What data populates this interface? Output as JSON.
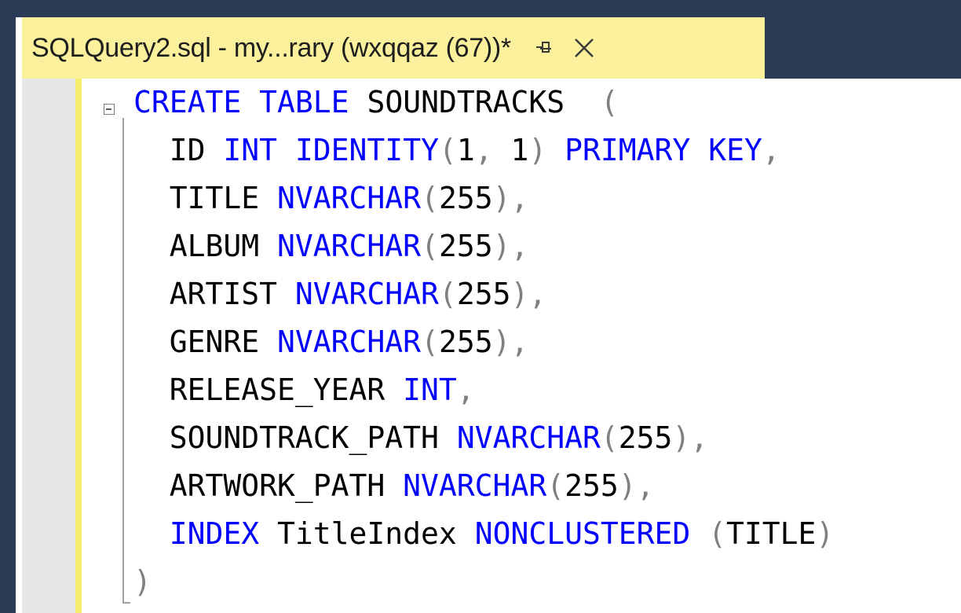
{
  "tab": {
    "title": "SQLQuery2.sql - my...rary (wxqqaz (67))*",
    "pin_glyph": "†",
    "pin_icon": "pin-icon",
    "close_icon": "close-icon"
  },
  "colors": {
    "keyword": "#0000ff",
    "punctuation": "#808080",
    "identifier": "#000000",
    "tab_background": "#fbf09c",
    "chrome": "#2b3a55",
    "change_bar": "#f6ee6e"
  },
  "code_lines": [
    [
      {
        "t": "CREATE",
        "c": "kw"
      },
      {
        "t": " ",
        "c": "tx"
      },
      {
        "t": "TABLE",
        "c": "kw"
      },
      {
        "t": " SOUNDTRACKS  ",
        "c": "tx"
      },
      {
        "t": "(",
        "c": "gr"
      }
    ],
    [
      {
        "t": "  ID ",
        "c": "tx"
      },
      {
        "t": "INT",
        "c": "kw"
      },
      {
        "t": " ",
        "c": "tx"
      },
      {
        "t": "IDENTITY",
        "c": "kw"
      },
      {
        "t": "(",
        "c": "gr"
      },
      {
        "t": "1",
        "c": "tx"
      },
      {
        "t": ", ",
        "c": "gr"
      },
      {
        "t": "1",
        "c": "tx"
      },
      {
        "t": ")",
        "c": "gr"
      },
      {
        "t": " ",
        "c": "tx"
      },
      {
        "t": "PRIMARY",
        "c": "kw"
      },
      {
        "t": " ",
        "c": "tx"
      },
      {
        "t": "KEY",
        "c": "kw"
      },
      {
        "t": ",",
        "c": "gr"
      }
    ],
    [
      {
        "t": "  TITLE ",
        "c": "tx"
      },
      {
        "t": "NVARCHAR",
        "c": "kw"
      },
      {
        "t": "(",
        "c": "gr"
      },
      {
        "t": "255",
        "c": "tx"
      },
      {
        "t": "),",
        "c": "gr"
      }
    ],
    [
      {
        "t": "  ALBUM ",
        "c": "tx"
      },
      {
        "t": "NVARCHAR",
        "c": "kw"
      },
      {
        "t": "(",
        "c": "gr"
      },
      {
        "t": "255",
        "c": "tx"
      },
      {
        "t": "),",
        "c": "gr"
      }
    ],
    [
      {
        "t": "  ARTIST ",
        "c": "tx"
      },
      {
        "t": "NVARCHAR",
        "c": "kw"
      },
      {
        "t": "(",
        "c": "gr"
      },
      {
        "t": "255",
        "c": "tx"
      },
      {
        "t": "),",
        "c": "gr"
      }
    ],
    [
      {
        "t": "  GENRE ",
        "c": "tx"
      },
      {
        "t": "NVARCHAR",
        "c": "kw"
      },
      {
        "t": "(",
        "c": "gr"
      },
      {
        "t": "255",
        "c": "tx"
      },
      {
        "t": "),",
        "c": "gr"
      }
    ],
    [
      {
        "t": "  RELEASE_YEAR ",
        "c": "tx"
      },
      {
        "t": "INT",
        "c": "kw"
      },
      {
        "t": ",",
        "c": "gr"
      }
    ],
    [
      {
        "t": "  SOUNDTRACK_PATH ",
        "c": "tx"
      },
      {
        "t": "NVARCHAR",
        "c": "kw"
      },
      {
        "t": "(",
        "c": "gr"
      },
      {
        "t": "255",
        "c": "tx"
      },
      {
        "t": "),",
        "c": "gr"
      }
    ],
    [
      {
        "t": "  ARTWORK_PATH ",
        "c": "tx"
      },
      {
        "t": "NVARCHAR",
        "c": "kw"
      },
      {
        "t": "(",
        "c": "gr"
      },
      {
        "t": "255",
        "c": "tx"
      },
      {
        "t": "),",
        "c": "gr"
      }
    ],
    [
      {
        "t": "  ",
        "c": "tx"
      },
      {
        "t": "INDEX",
        "c": "kw"
      },
      {
        "t": " TitleIndex ",
        "c": "tx"
      },
      {
        "t": "NONCLUSTERED",
        "c": "kw"
      },
      {
        "t": " ",
        "c": "tx"
      },
      {
        "t": "(",
        "c": "gr"
      },
      {
        "t": "TITLE",
        "c": "tx"
      },
      {
        "t": ")",
        "c": "gr"
      }
    ],
    [
      {
        "t": ")",
        "c": "gr"
      }
    ]
  ]
}
